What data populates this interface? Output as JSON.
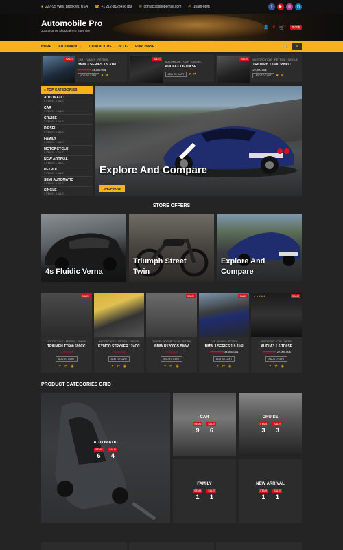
{
  "topbar": {
    "address": "227-95 West Brooklyn, USA",
    "phone": "+1 212-8123456789",
    "email": "contact@shopemail.com",
    "hours": "10am-8pm",
    "social": [
      "facebook-icon",
      "youtube-icon",
      "instagram-icon",
      "linkedin-icon"
    ]
  },
  "header": {
    "title": "Automobile Pro",
    "tagline": "Just another Shopical Pro Sites site",
    "cart_count": "0",
    "cart_total": "0.00$"
  },
  "nav": {
    "items": [
      "HOME",
      "AUTOMATIC",
      "CONTACT US",
      "BLOG",
      "PURCHASE"
    ],
    "search_label": "SEARCH"
  },
  "top_products": [
    {
      "meta": "CAR · FAMILY · PETROL",
      "name": "BMW 3 SERIES 1.9 316I",
      "old": "30,000.00$",
      "new": "34,000.00$",
      "add": "ADD TO CART",
      "sale": "SALE!"
    },
    {
      "meta": "AUTOMATIC · CAR · DIESEL",
      "name": "AUDI A3 1.6 TDI SE",
      "old": "",
      "new": "",
      "add": "ADD TO CART",
      "sale": "SALE!"
    },
    {
      "meta": "MOTORCYCLE · PETROL · SINGLE",
      "name": "TRIUMPH TT600 599CC",
      "old": "",
      "new": "22,000.00$",
      "add": "ADD TO CART",
      "sale": "SALE!"
    }
  ],
  "categories": {
    "heading": "TOP CATEGORIES",
    "items": [
      {
        "name": "AUTOMATIC",
        "sub": "6 ITEMS · 4 SALE!"
      },
      {
        "name": "CAR",
        "sub": "9 ITEMS · 6 SALE!"
      },
      {
        "name": "CRUISE",
        "sub": "3 ITEMS · 3 SALE!"
      },
      {
        "name": "DIESEL",
        "sub": "6 ITEMS · 4 SALE!"
      },
      {
        "name": "FAMILY",
        "sub": "1 ITEMS · 1 SALE!"
      },
      {
        "name": "MOTORCYCLE",
        "sub": "6 ITEMS · 5 SALE!"
      },
      {
        "name": "NEW ARRIVAL",
        "sub": "1 ITEMS · 1 SALE!"
      },
      {
        "name": "PETROL",
        "sub": "9 ITEMS · 6 SALE!"
      },
      {
        "name": "SEMI AUTOMATIC",
        "sub": "3 ITEMS · 3 SALE!"
      },
      {
        "name": "SINGLE",
        "sub": "3 ITEMS · 3 SALE!"
      }
    ]
  },
  "hero": {
    "title": "Explore And Compare",
    "button": "SHOP NOW"
  },
  "store_offers": {
    "title": "STORE OFFERS",
    "items": [
      {
        "label_1": "4s Fluidic Verna",
        "label_2": ""
      },
      {
        "label_1": "Triumph Street",
        "label_2": "Twin"
      },
      {
        "label_1": "Explore And",
        "label_2": "Compare"
      }
    ]
  },
  "cards": [
    {
      "meta": "MOTORCYCLE · PETROL · SINGLE",
      "name": "TRIUMPH TT600 599CC",
      "old": "",
      "new": "22,000.00$",
      "add": "ADD TO CART",
      "sale": "SALE!"
    },
    {
      "meta": "MOTORCYCLE · PETROL · SINGLE",
      "name": "KYMCO STRYKER 124CC",
      "old": "",
      "new": "8,000.00$",
      "add": "ADD TO CART",
      "sale": ""
    },
    {
      "meta": "CRUISE · MOTORCYCLE · PETROL",
      "name": "BMW R1200GS BMW",
      "old": "",
      "new": "7,500.00$",
      "add": "ADD TO CART",
      "sale": "SALE!"
    },
    {
      "meta": "CAR · FAMILY · PETROL",
      "name": "BMW 3 SERIES 1.9 316I",
      "old": "35,000.00$",
      "new": "34,000.00$",
      "add": "ADD TO CART",
      "sale": "SALE!"
    },
    {
      "meta": "AUTOMATIC · CAR · DIESEL",
      "name": "AUDI A3 1.6 TDI SE",
      "old": "30,000.00$",
      "new": "27,000.00$",
      "add": "ADD TO CART",
      "sale": "SALE!"
    }
  ],
  "grid": {
    "title": "PRODUCT CATEGORIES GRID",
    "items_label": "ITEMS",
    "sale_label": "SALE!",
    "automatic": {
      "name": "AUTOMATIC",
      "items": "6",
      "sale": "4"
    },
    "car": {
      "name": "CAR",
      "items": "9",
      "sale": "6"
    },
    "cruise": {
      "name": "CRUISE",
      "items": "3",
      "sale": "3"
    },
    "family": {
      "name": "FAMILY",
      "items": "1",
      "sale": "1"
    },
    "new_arrival": {
      "name": "NEW ARRIVAL",
      "items": "1",
      "sale": "1"
    }
  },
  "colors": {
    "accent": "#f5b21b",
    "sale": "#d3121d",
    "bg": "#242424"
  }
}
